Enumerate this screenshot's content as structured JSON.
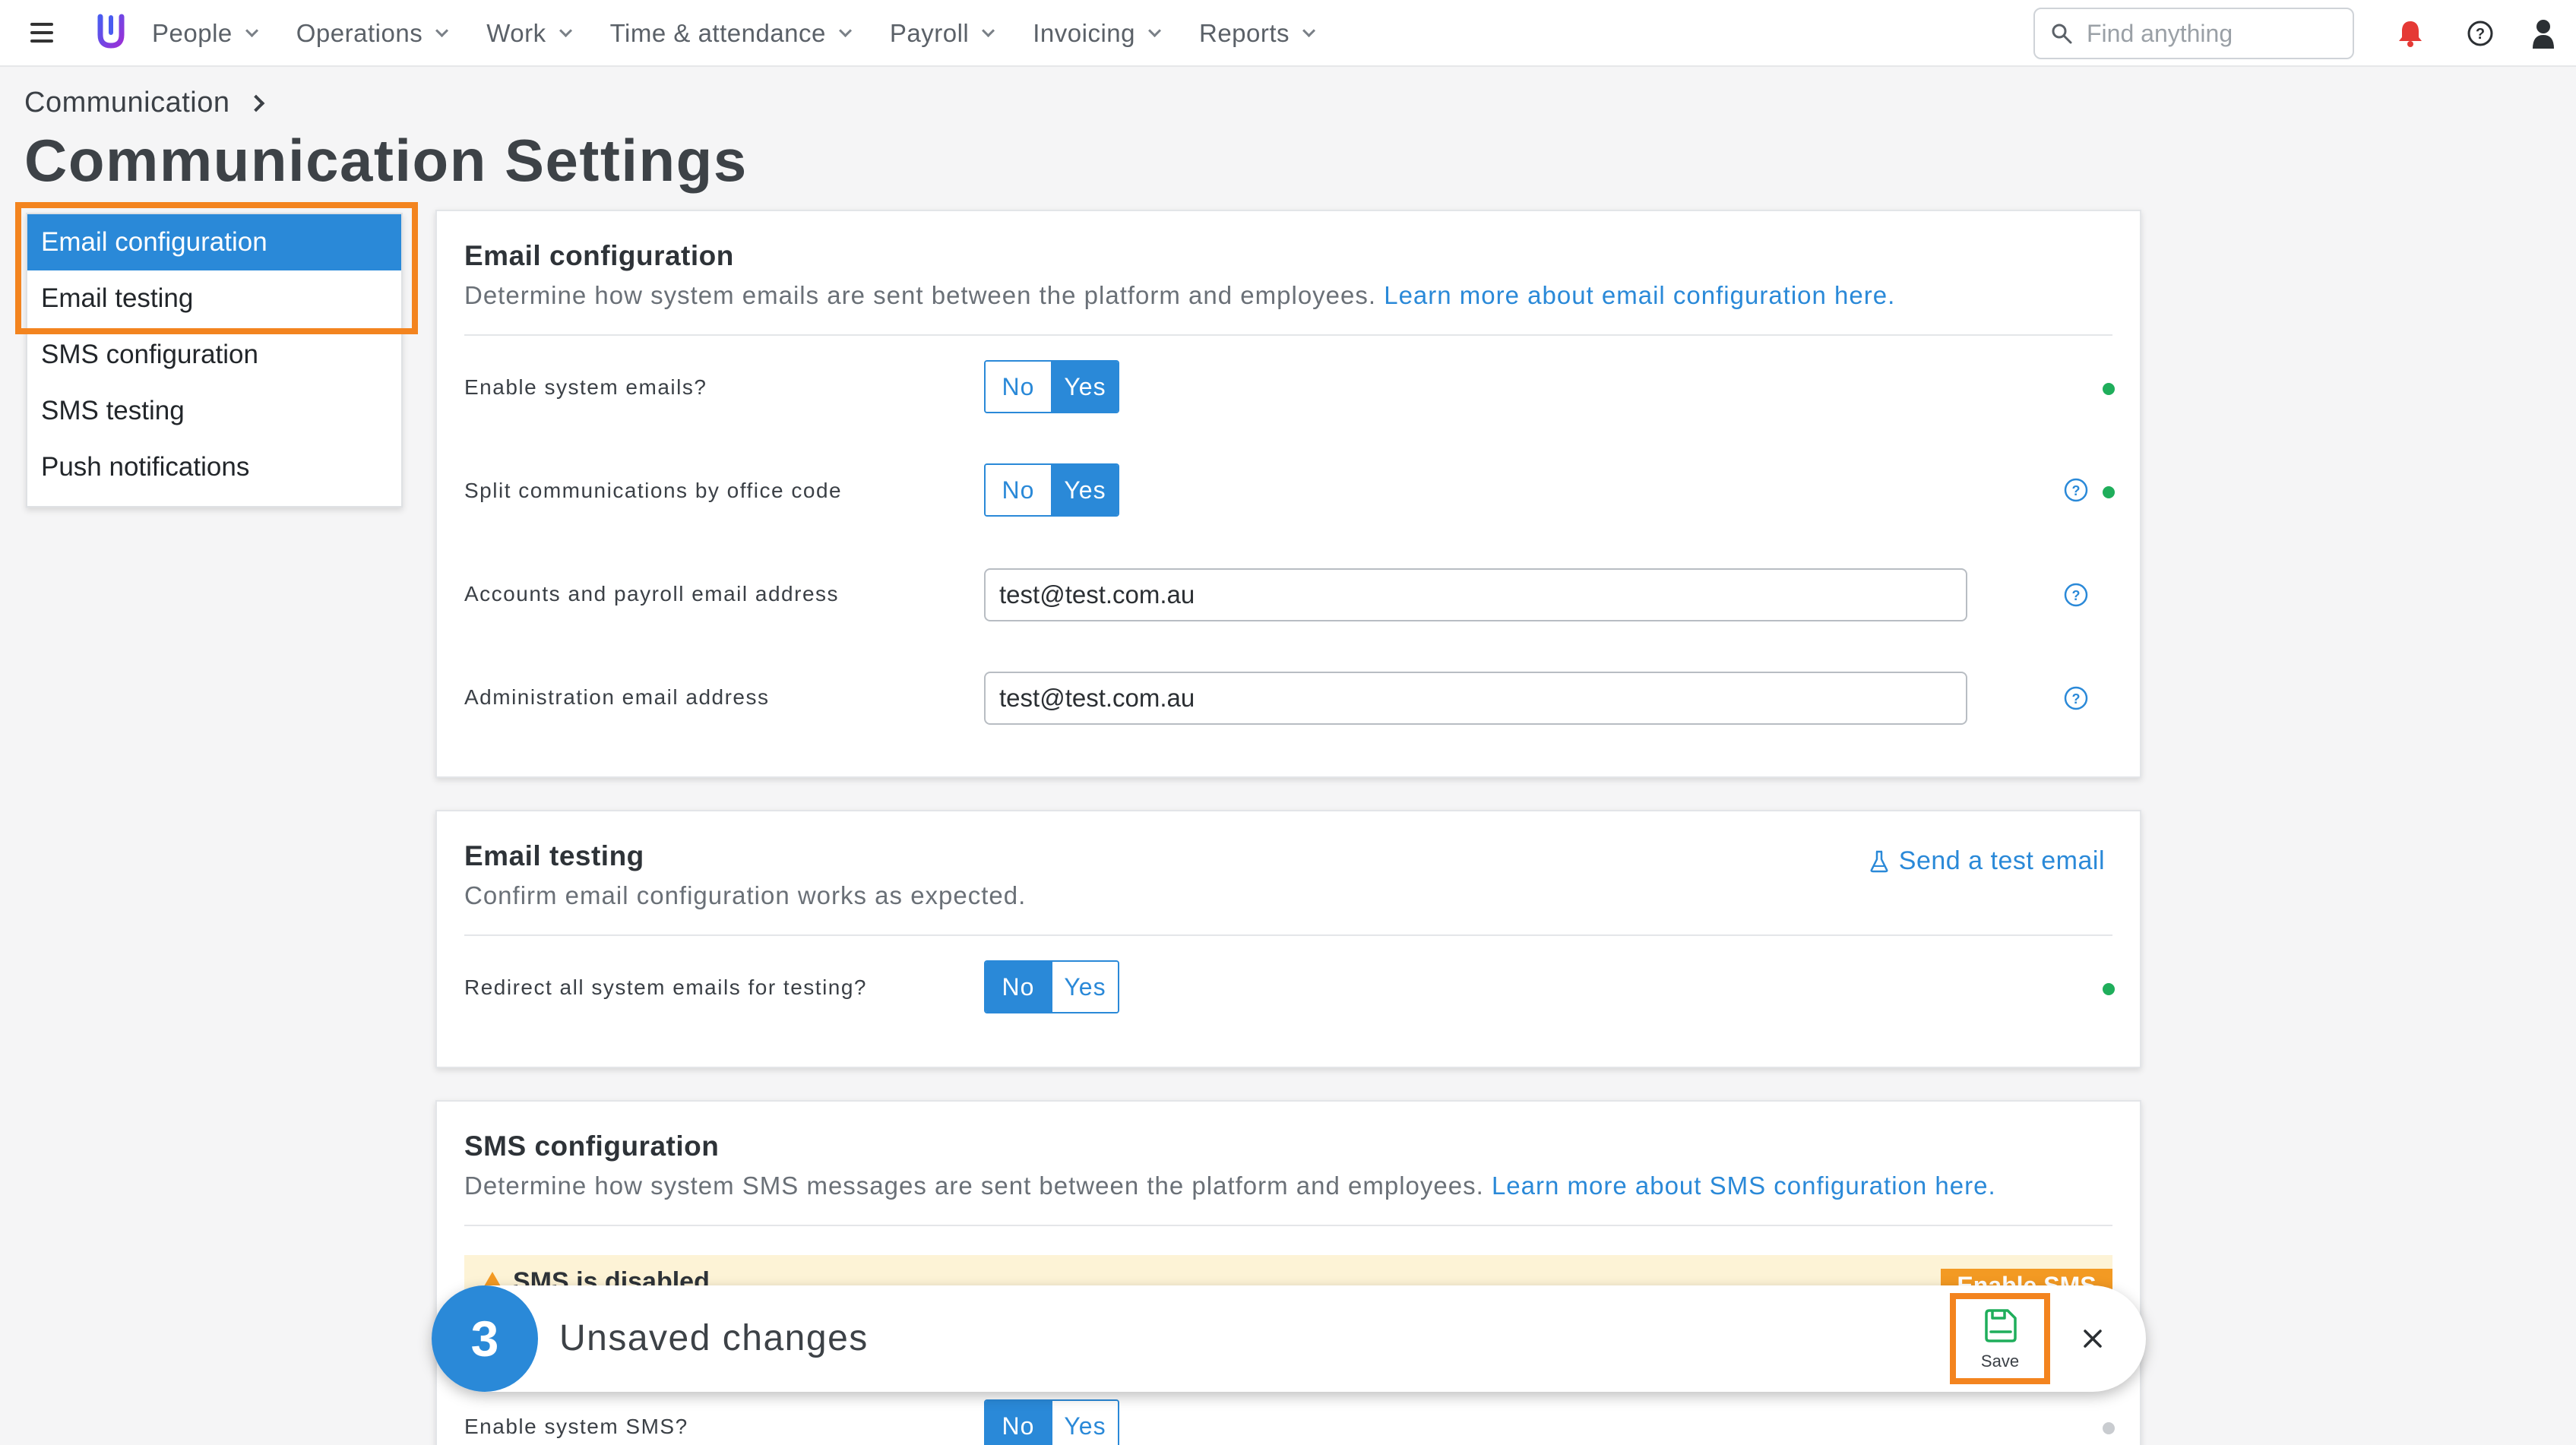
{
  "nav": {
    "items": [
      {
        "label": "People"
      },
      {
        "label": "Operations"
      },
      {
        "label": "Work"
      },
      {
        "label": "Time & attendance"
      },
      {
        "label": "Payroll"
      },
      {
        "label": "Invoicing"
      },
      {
        "label": "Reports"
      }
    ],
    "search_placeholder": "Find anything"
  },
  "header": {
    "breadcrumb": "Communication",
    "title": "Communication Settings"
  },
  "sidebar": {
    "items": [
      {
        "label": "Email configuration",
        "active": true
      },
      {
        "label": "Email testing"
      },
      {
        "label": "SMS configuration"
      },
      {
        "label": "SMS testing"
      },
      {
        "label": "Push notifications"
      }
    ]
  },
  "email_config": {
    "title": "Email configuration",
    "desc": "Determine how system emails are sent between the platform and employees.",
    "link": "Learn more about email configuration here.",
    "enable_label": "Enable system emails?",
    "enable_value": "Yes",
    "split_label": "Split communications by office code",
    "split_value": "Yes",
    "accounts_label": "Accounts and payroll email address",
    "accounts_value": "test@test.com.au",
    "admin_label": "Administration email address",
    "admin_value": "test@test.com.au",
    "no": "No",
    "yes": "Yes"
  },
  "email_testing": {
    "title": "Email testing",
    "desc": "Confirm email configuration works as expected.",
    "send_test": "Send a test email",
    "redirect_label": "Redirect all system emails for testing?",
    "redirect_value": "No",
    "no": "No",
    "yes": "Yes"
  },
  "sms_config": {
    "title": "SMS configuration",
    "desc": "Determine how system SMS messages are sent between the platform and employees.",
    "link": "Learn more about SMS configuration here.",
    "warning": "SMS is disabled",
    "enable_button": "Enable SMS",
    "enable_label": "Enable system SMS?",
    "enable_value": "No",
    "no": "No",
    "yes": "Yes"
  },
  "unsaved": {
    "count": "3",
    "text": "Unsaved changes",
    "save_label": "Save"
  },
  "colors": {
    "accent": "#2a89d8",
    "highlight": "#f3841f",
    "status_ok": "#1fae5b",
    "notification": "#e53935"
  }
}
